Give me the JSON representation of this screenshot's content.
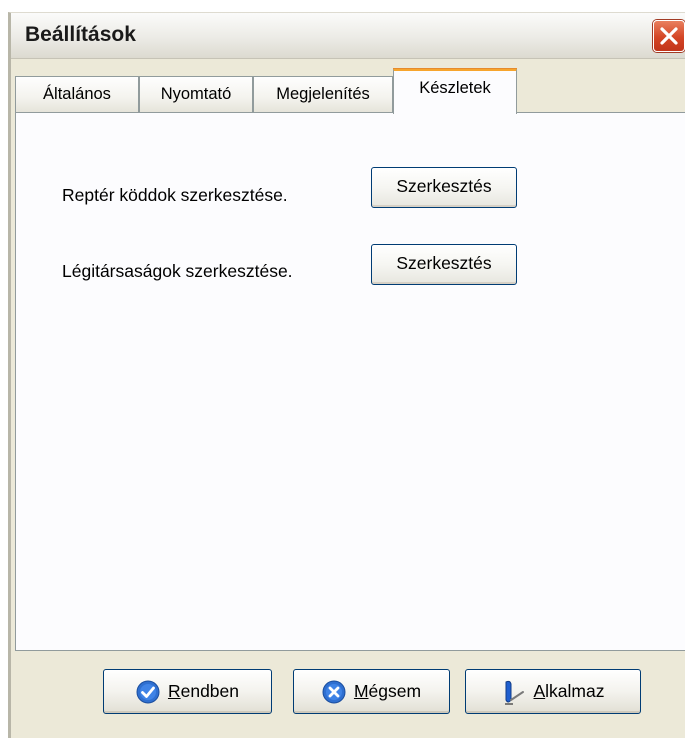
{
  "window": {
    "title": "Beállítások"
  },
  "tabs": [
    {
      "label": "Általános"
    },
    {
      "label": "Nyomtató"
    },
    {
      "label": "Megjelenítés"
    },
    {
      "label": "Készletek",
      "active": true
    }
  ],
  "panel": {
    "rows": [
      {
        "label": "Reptér köddok szerkesztése.",
        "button": "Szerkesztés"
      },
      {
        "label": "Légitársaságok szerkesztése.",
        "button": "Szerkesztés"
      }
    ]
  },
  "footer": {
    "ok": {
      "mnemonic": "R",
      "rest": "endben",
      "icon": "check-circle-icon"
    },
    "cancel": {
      "mnemonic": "M",
      "rest": "égsem",
      "icon": "x-circle-icon"
    },
    "apply": {
      "mnemonic": "A",
      "rest": "lkalmaz",
      "icon": "pen-icon"
    }
  },
  "colors": {
    "active_tab_accent": "#f7a52c",
    "close_button": "#d44525",
    "button_border": "#003c74"
  }
}
